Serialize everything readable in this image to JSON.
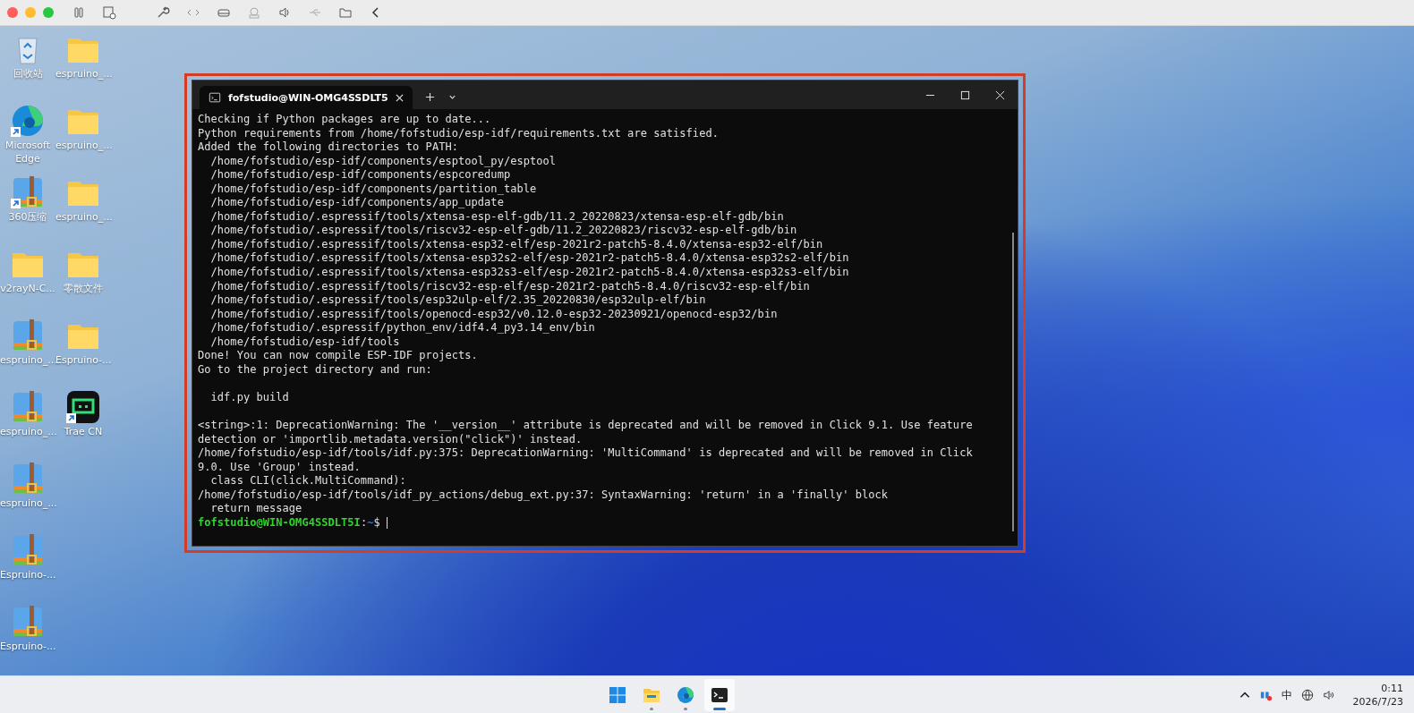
{
  "desktop": {
    "columns": [
      [
        {
          "kind": "recycle-bin",
          "label": "回收站"
        },
        {
          "kind": "edge",
          "label": "Microsoft Edge",
          "shortcut": true
        },
        {
          "kind": "zip",
          "label": "360压缩",
          "shortcut": true
        },
        {
          "kind": "folder",
          "label": "v2rayN-C..."
        },
        {
          "kind": "zip",
          "label": "espruino_...",
          "shortcut": false
        },
        {
          "kind": "zip",
          "label": "espruino_...",
          "shortcut": false
        },
        {
          "kind": "zip",
          "label": "espruino_...",
          "shortcut": false
        },
        {
          "kind": "zip",
          "label": "Espruino-...",
          "shortcut": false
        },
        {
          "kind": "zip",
          "label": "Espruino-...",
          "shortcut": false
        }
      ],
      [
        {
          "kind": "folder",
          "label": "espruino_..."
        },
        {
          "kind": "folder",
          "label": "espruino_..."
        },
        {
          "kind": "folder",
          "label": "espruino_..."
        },
        {
          "kind": "folder",
          "label": "零散文件"
        },
        {
          "kind": "folder",
          "label": "Espruino-..."
        },
        {
          "kind": "app",
          "label": "Trae CN",
          "shortcut": true
        }
      ]
    ]
  },
  "terminal": {
    "tab_title": "fofstudio@WIN-OMG4SSDLT5",
    "lines": [
      {
        "kind": "text",
        "text": "Checking if Python packages are up to date..."
      },
      {
        "kind": "text",
        "text": "Python requirements from /home/fofstudio/esp-idf/requirements.txt are satisfied."
      },
      {
        "kind": "text",
        "text": "Added the following directories to PATH:"
      },
      {
        "kind": "text",
        "text": "  /home/fofstudio/esp-idf/components/esptool_py/esptool"
      },
      {
        "kind": "text",
        "text": "  /home/fofstudio/esp-idf/components/espcoredump"
      },
      {
        "kind": "text",
        "text": "  /home/fofstudio/esp-idf/components/partition_table"
      },
      {
        "kind": "text",
        "text": "  /home/fofstudio/esp-idf/components/app_update"
      },
      {
        "kind": "text",
        "text": "  /home/fofstudio/.espressif/tools/xtensa-esp-elf-gdb/11.2_20220823/xtensa-esp-elf-gdb/bin"
      },
      {
        "kind": "text",
        "text": "  /home/fofstudio/.espressif/tools/riscv32-esp-elf-gdb/11.2_20220823/riscv32-esp-elf-gdb/bin"
      },
      {
        "kind": "text",
        "text": "  /home/fofstudio/.espressif/tools/xtensa-esp32-elf/esp-2021r2-patch5-8.4.0/xtensa-esp32-elf/bin"
      },
      {
        "kind": "text",
        "text": "  /home/fofstudio/.espressif/tools/xtensa-esp32s2-elf/esp-2021r2-patch5-8.4.0/xtensa-esp32s2-elf/bin"
      },
      {
        "kind": "text",
        "text": "  /home/fofstudio/.espressif/tools/xtensa-esp32s3-elf/esp-2021r2-patch5-8.4.0/xtensa-esp32s3-elf/bin"
      },
      {
        "kind": "text",
        "text": "  /home/fofstudio/.espressif/tools/riscv32-esp-elf/esp-2021r2-patch5-8.4.0/riscv32-esp-elf/bin"
      },
      {
        "kind": "text",
        "text": "  /home/fofstudio/.espressif/tools/esp32ulp-elf/2.35_20220830/esp32ulp-elf/bin"
      },
      {
        "kind": "text",
        "text": "  /home/fofstudio/.espressif/tools/openocd-esp32/v0.12.0-esp32-20230921/openocd-esp32/bin"
      },
      {
        "kind": "text",
        "text": "  /home/fofstudio/.espressif/python_env/idf4.4_py3.14_env/bin"
      },
      {
        "kind": "text",
        "text": "  /home/fofstudio/esp-idf/tools"
      },
      {
        "kind": "text",
        "text": "Done! You can now compile ESP-IDF projects."
      },
      {
        "kind": "text",
        "text": "Go to the project directory and run:"
      },
      {
        "kind": "blank"
      },
      {
        "kind": "text",
        "text": "  idf.py build"
      },
      {
        "kind": "blank"
      },
      {
        "kind": "text",
        "text": "<string>:1: DeprecationWarning: The '__version__' attribute is deprecated and will be removed in Click 9.1. Use feature"
      },
      {
        "kind": "text",
        "text": "detection or 'importlib.metadata.version(\"click\")' instead."
      },
      {
        "kind": "text",
        "text": "/home/fofstudio/esp-idf/tools/idf.py:375: DeprecationWarning: 'MultiCommand' is deprecated and will be removed in Click"
      },
      {
        "kind": "text",
        "text": "9.0. Use 'Group' instead."
      },
      {
        "kind": "text",
        "text": "  class CLI(click.MultiCommand):"
      },
      {
        "kind": "text",
        "text": "/home/fofstudio/esp-idf/tools/idf_py_actions/debug_ext.py:37: SyntaxWarning: 'return' in a 'finally' block"
      },
      {
        "kind": "text",
        "text": "  return message"
      },
      {
        "kind": "prompt",
        "user": "fofstudio@WIN-OMG4SSDLT5I",
        "sep": ":",
        "path": "~",
        "symbol": "$"
      }
    ]
  },
  "taskbar": {
    "apps": [
      {
        "kind": "start",
        "selected": false
      },
      {
        "kind": "explorer",
        "selected": false
      },
      {
        "kind": "edge",
        "selected": false
      },
      {
        "kind": "terminal",
        "selected": true
      }
    ],
    "input_method": "中",
    "time": "0:11",
    "date": "2026/7/23"
  }
}
